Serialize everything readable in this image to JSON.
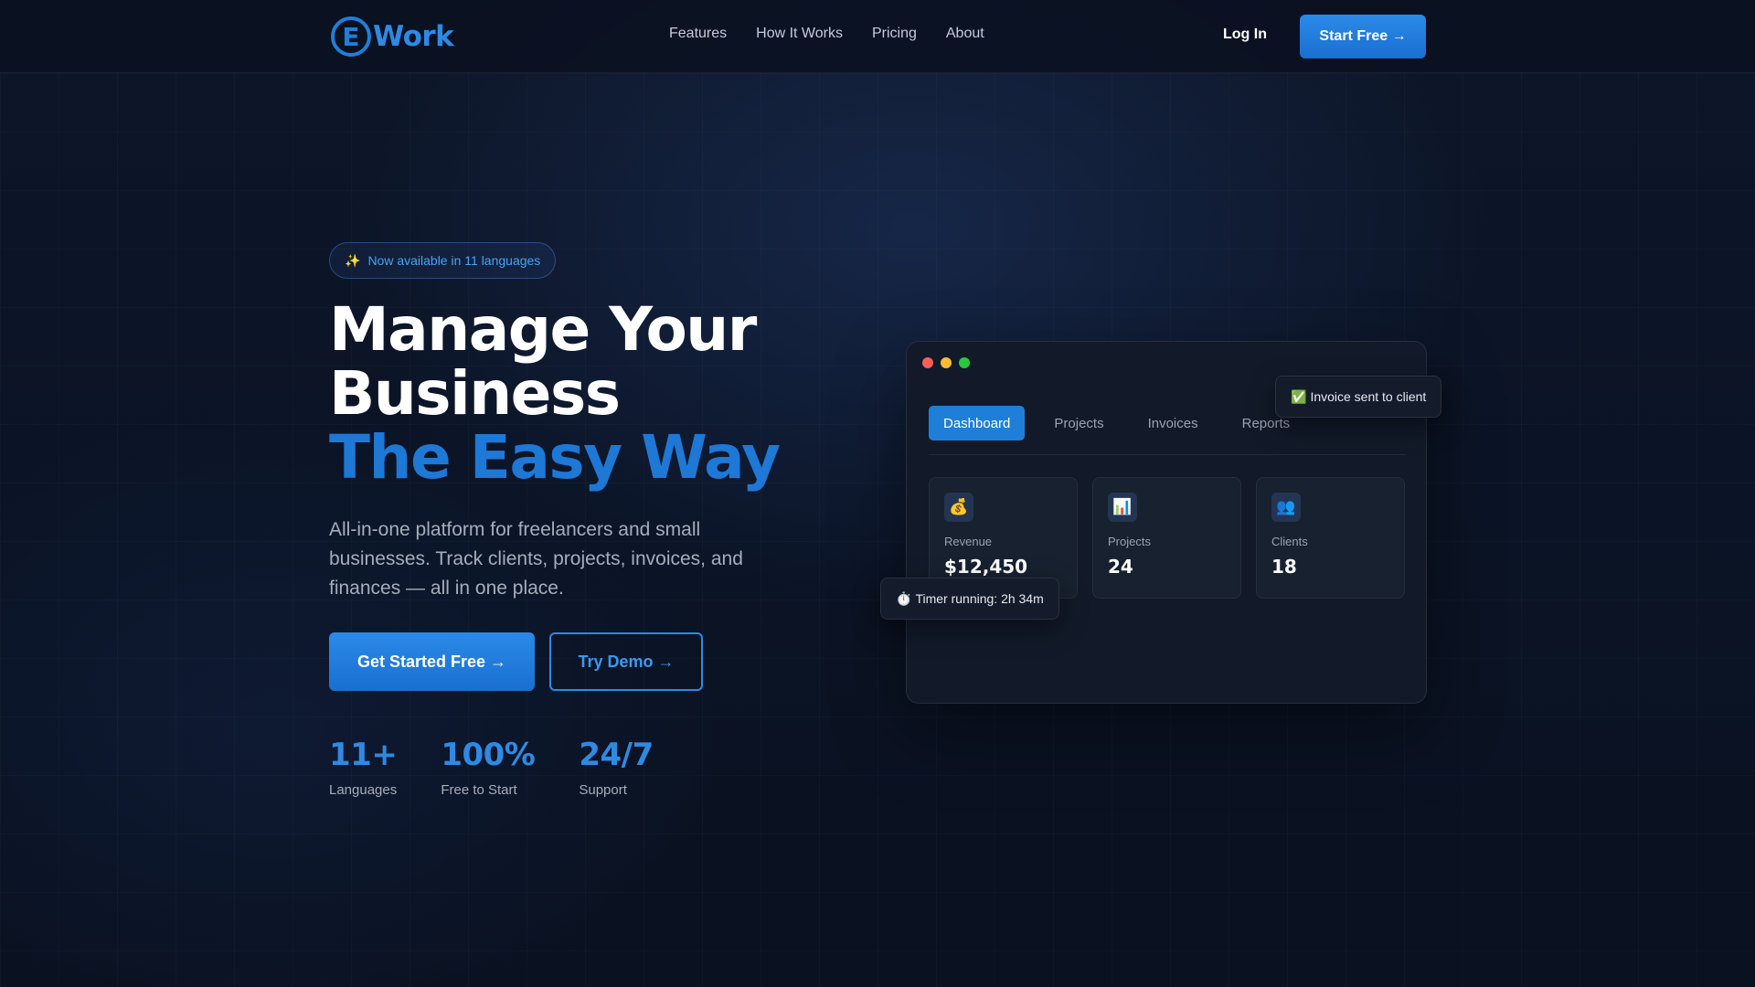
{
  "brand": {
    "logo_letter": "E",
    "name": "Work"
  },
  "nav": {
    "links": [
      "Features",
      "How It Works",
      "Pricing",
      "About"
    ],
    "login": "Log In",
    "start_free": "Start Free →"
  },
  "hero": {
    "badge_icon": "✨",
    "badge_text": "Now available in 11 languages",
    "title_line1": "Manage Your",
    "title_line2": "Business",
    "title_line3": "The Easy Way",
    "subtitle": "All-in-one platform for freelancers and small businesses. Track clients, projects, invoices, and finances — all in one place.",
    "cta_primary": "Get Started Free →",
    "cta_secondary": "Try Demo →",
    "stats": [
      {
        "value": "11+",
        "label": "Languages"
      },
      {
        "value": "100%",
        "label": "Free to Start"
      },
      {
        "value": "24/7",
        "label": "Support"
      }
    ]
  },
  "app_preview": {
    "window_dots": [
      "#ff5f57",
      "#febc2e",
      "#28c840"
    ],
    "tabs": [
      "Dashboard",
      "Projects",
      "Invoices",
      "Reports"
    ],
    "active_tab": "Dashboard",
    "cards": [
      {
        "icon": "money-bag-icon",
        "glyph": "💰",
        "label": "Revenue",
        "value": "$12,450"
      },
      {
        "icon": "bar-chart-icon",
        "glyph": "📊",
        "label": "Projects",
        "value": "24"
      },
      {
        "icon": "users-icon",
        "glyph": "👥",
        "label": "Clients",
        "value": "18"
      }
    ],
    "notification_invoice": {
      "icon": "✅",
      "text": "Invoice sent to client"
    },
    "notification_timer": {
      "icon": "⏱️",
      "text": "Timer running: 2h 34m"
    }
  },
  "colors": {
    "accent": "#1f7fd8",
    "background": "#0b1324"
  }
}
